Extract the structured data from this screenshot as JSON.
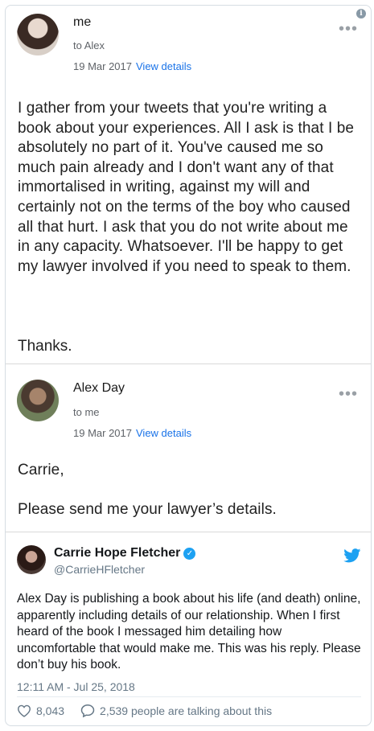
{
  "email1": {
    "sender": "me",
    "to": "to Alex",
    "date": "19 Mar 2017",
    "view_details": "View details",
    "body": "I gather from your tweets that you're writing a book about your experiences. All I ask is that I be absolutely no part of it. You've caused me so much pain already and I don't want any of that immortalised in writing, against my will and certainly not on the terms of the boy who caused all that hurt. I ask that you do not write about me in any capacity. Whatsoever. I'll be happy to get my lawyer involved if you need to speak to them.",
    "signoff": "Thanks."
  },
  "email2": {
    "sender": "Alex Day",
    "to": "to me",
    "date": "19 Mar 2017",
    "view_details": "View details",
    "greeting": "Carrie,",
    "body": "Please send me your lawyer’s details."
  },
  "tweet": {
    "name": "Carrie Hope Fletcher",
    "handle": "@CarrieHFletcher",
    "text": "Alex Day is publishing a book about his life (and death) online, apparently including details of our relationship. When I first heard of the book I messaged him detailing how uncomfortable that would make me. This was his reply. Please don’t buy his book.",
    "timestamp": "12:11 AM - Jul 25, 2018",
    "likes": "8,043",
    "talking": "2,539 people are talking about this"
  },
  "icons": {
    "info": "info-icon",
    "more": "more-dots-icon",
    "verified": "verified-badge-icon",
    "twitter": "twitter-bird-icon",
    "like": "heart-icon",
    "reply": "speech-bubble-icon"
  },
  "colors": {
    "link": "#1a73e8",
    "twitter_blue": "#1da1f2",
    "muted": "#657786"
  }
}
